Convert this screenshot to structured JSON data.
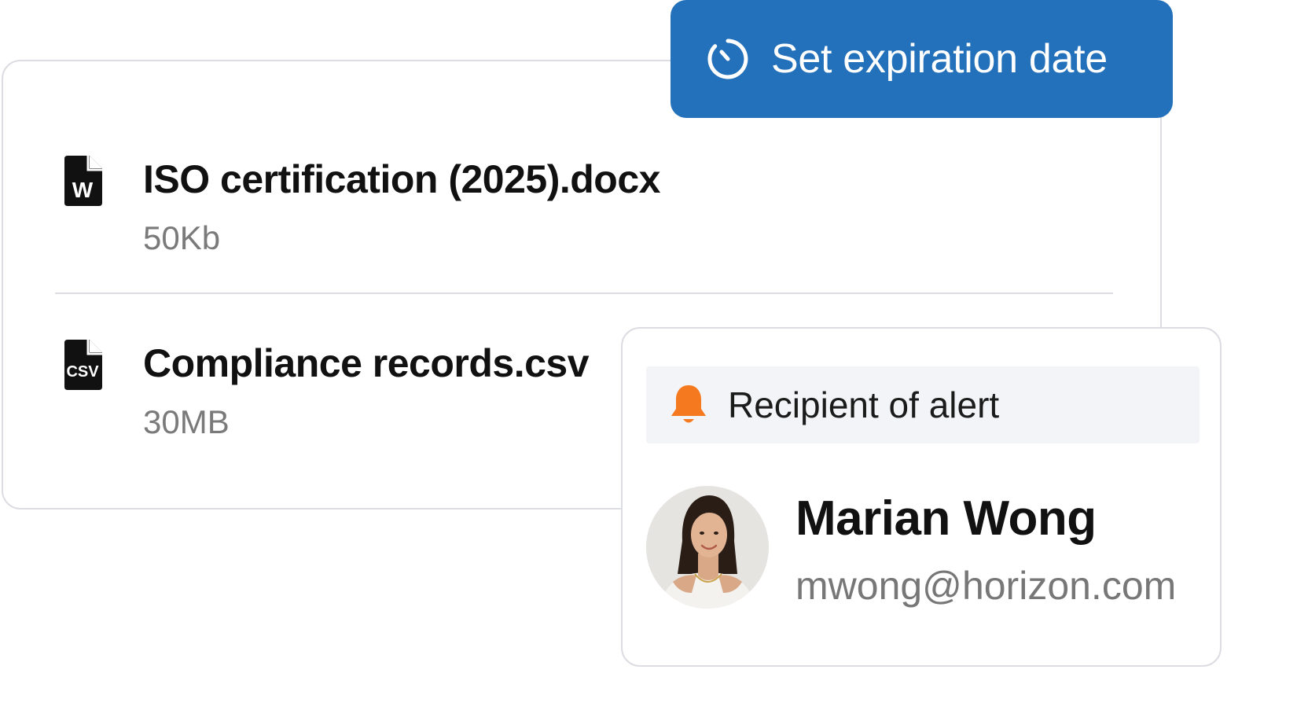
{
  "expiration_button": {
    "label": "Set expiration date",
    "icon": "timer-icon",
    "color": "#2370bb"
  },
  "files": [
    {
      "name": "ISO certification (2025).docx",
      "size": "50Kb",
      "icon": "word-file-icon",
      "icon_letter": "W"
    },
    {
      "name": "Compliance records.csv",
      "size": "30MB",
      "icon": "csv-file-icon",
      "icon_letter": "CSV"
    }
  ],
  "alert": {
    "header_label": "Recipient of alert",
    "header_icon": "bell-icon",
    "bell_color": "#f5791f",
    "recipient": {
      "name": "Marian Wong",
      "email": "mwong@horizon.com"
    }
  }
}
